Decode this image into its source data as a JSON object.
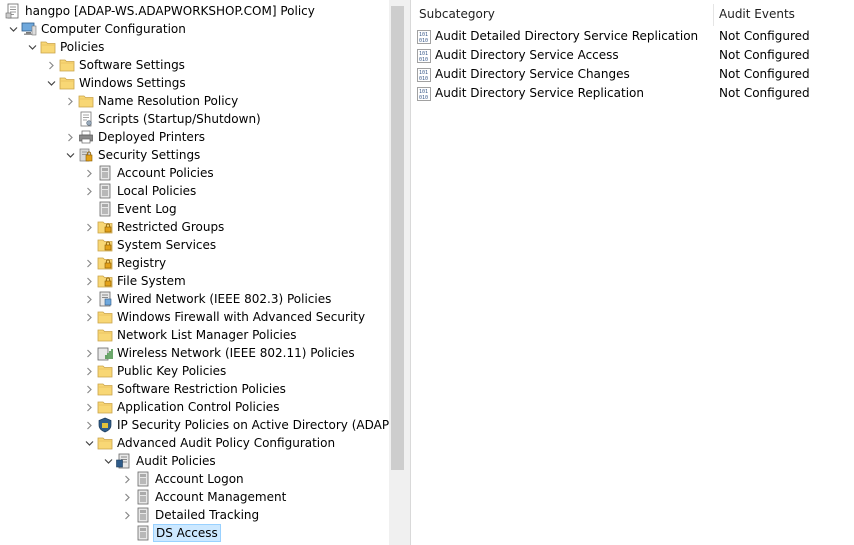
{
  "tree": {
    "items": [
      {
        "label": "hangpo [ADAP-WS.ADAPWORKSHOP.COM] Policy",
        "icon": "gpo-policy-icon",
        "exp": "none",
        "level": 0,
        "name": "tree-root-policy"
      },
      {
        "label": "Computer Configuration",
        "icon": "computer-icon",
        "exp": "open",
        "level": 0,
        "name": "tree-computer-configuration"
      },
      {
        "label": "Policies",
        "icon": "folder-icon",
        "exp": "open",
        "level": 1,
        "name": "tree-policies"
      },
      {
        "label": "Software Settings",
        "icon": "folder-icon",
        "exp": "closed",
        "level": 2,
        "name": "tree-software-settings"
      },
      {
        "label": "Windows Settings",
        "icon": "folder-icon",
        "exp": "open",
        "level": 2,
        "name": "tree-windows-settings"
      },
      {
        "label": "Name Resolution Policy",
        "icon": "folder-icon",
        "exp": "closed",
        "level": 3,
        "name": "tree-name-resolution-policy"
      },
      {
        "label": "Scripts (Startup/Shutdown)",
        "icon": "script-icon",
        "exp": "none",
        "level": 3,
        "name": "tree-scripts"
      },
      {
        "label": "Deployed Printers",
        "icon": "printer-icon",
        "exp": "closed",
        "level": 3,
        "name": "tree-deployed-printers"
      },
      {
        "label": "Security Settings",
        "icon": "security-icon",
        "exp": "open",
        "level": 3,
        "name": "tree-security-settings"
      },
      {
        "label": "Account Policies",
        "icon": "policy-book-icon",
        "exp": "closed",
        "level": 4,
        "name": "tree-account-policies"
      },
      {
        "label": "Local Policies",
        "icon": "policy-book-icon",
        "exp": "closed",
        "level": 4,
        "name": "tree-local-policies"
      },
      {
        "label": "Event Log",
        "icon": "policy-book-icon",
        "exp": "none",
        "level": 4,
        "name": "tree-event-log"
      },
      {
        "label": "Restricted Groups",
        "icon": "locked-folder-icon",
        "exp": "closed",
        "level": 4,
        "name": "tree-restricted-groups"
      },
      {
        "label": "System Services",
        "icon": "locked-folder-icon",
        "exp": "none",
        "level": 4,
        "name": "tree-system-services"
      },
      {
        "label": "Registry",
        "icon": "locked-folder-icon",
        "exp": "closed",
        "level": 4,
        "name": "tree-registry"
      },
      {
        "label": "File System",
        "icon": "locked-folder-icon",
        "exp": "closed",
        "level": 4,
        "name": "tree-file-system"
      },
      {
        "label": "Wired Network (IEEE 802.3) Policies",
        "icon": "network-icon",
        "exp": "closed",
        "level": 4,
        "name": "tree-wired-network"
      },
      {
        "label": "Windows Firewall with Advanced Security",
        "icon": "folder-icon",
        "exp": "closed",
        "level": 4,
        "name": "tree-windows-firewall"
      },
      {
        "label": "Network List Manager Policies",
        "icon": "folder-icon",
        "exp": "none",
        "level": 4,
        "name": "tree-network-list-manager"
      },
      {
        "label": "Wireless Network (IEEE 802.11) Policies",
        "icon": "wireless-icon",
        "exp": "closed",
        "level": 4,
        "name": "tree-wireless-network"
      },
      {
        "label": "Public Key Policies",
        "icon": "folder-icon",
        "exp": "closed",
        "level": 4,
        "name": "tree-public-key-policies"
      },
      {
        "label": "Software Restriction Policies",
        "icon": "folder-icon",
        "exp": "closed",
        "level": 4,
        "name": "tree-software-restriction"
      },
      {
        "label": "Application Control Policies",
        "icon": "folder-icon",
        "exp": "closed",
        "level": 4,
        "name": "tree-application-control"
      },
      {
        "label": "IP Security Policies on Active Directory (ADAPWOR",
        "icon": "ip-security-icon",
        "exp": "closed",
        "level": 4,
        "name": "tree-ip-security"
      },
      {
        "label": "Advanced Audit Policy Configuration",
        "icon": "folder-icon",
        "exp": "open",
        "level": 4,
        "name": "tree-advanced-audit"
      },
      {
        "label": "Audit Policies",
        "icon": "audit-policies-icon",
        "exp": "open",
        "level": 5,
        "name": "tree-audit-policies"
      },
      {
        "label": "Account Logon",
        "icon": "policy-book-icon",
        "exp": "closed",
        "level": 6,
        "name": "tree-account-logon"
      },
      {
        "label": "Account Management",
        "icon": "policy-book-icon",
        "exp": "closed",
        "level": 6,
        "name": "tree-account-management"
      },
      {
        "label": "Detailed Tracking",
        "icon": "policy-book-icon",
        "exp": "closed",
        "level": 6,
        "name": "tree-detailed-tracking"
      },
      {
        "label": "DS Access",
        "icon": "policy-book-icon",
        "exp": "none",
        "level": 6,
        "selected": true,
        "name": "tree-ds-access"
      }
    ]
  },
  "list": {
    "columns": {
      "subcategory": "Subcategory",
      "audit_events": "Audit Events"
    },
    "rows": [
      {
        "subcategory": "Audit Detailed Directory Service Replication",
        "audit_events": "Not Configured"
      },
      {
        "subcategory": "Audit Directory Service Access",
        "audit_events": "Not Configured"
      },
      {
        "subcategory": "Audit Directory Service Changes",
        "audit_events": "Not Configured"
      },
      {
        "subcategory": "Audit Directory Service Replication",
        "audit_events": "Not Configured"
      }
    ],
    "row_icon": "binary-policy-icon"
  },
  "colors": {
    "selection_bg": "#cce8ff",
    "selection_border": "#99d1ff",
    "folder": "#f8d775"
  }
}
